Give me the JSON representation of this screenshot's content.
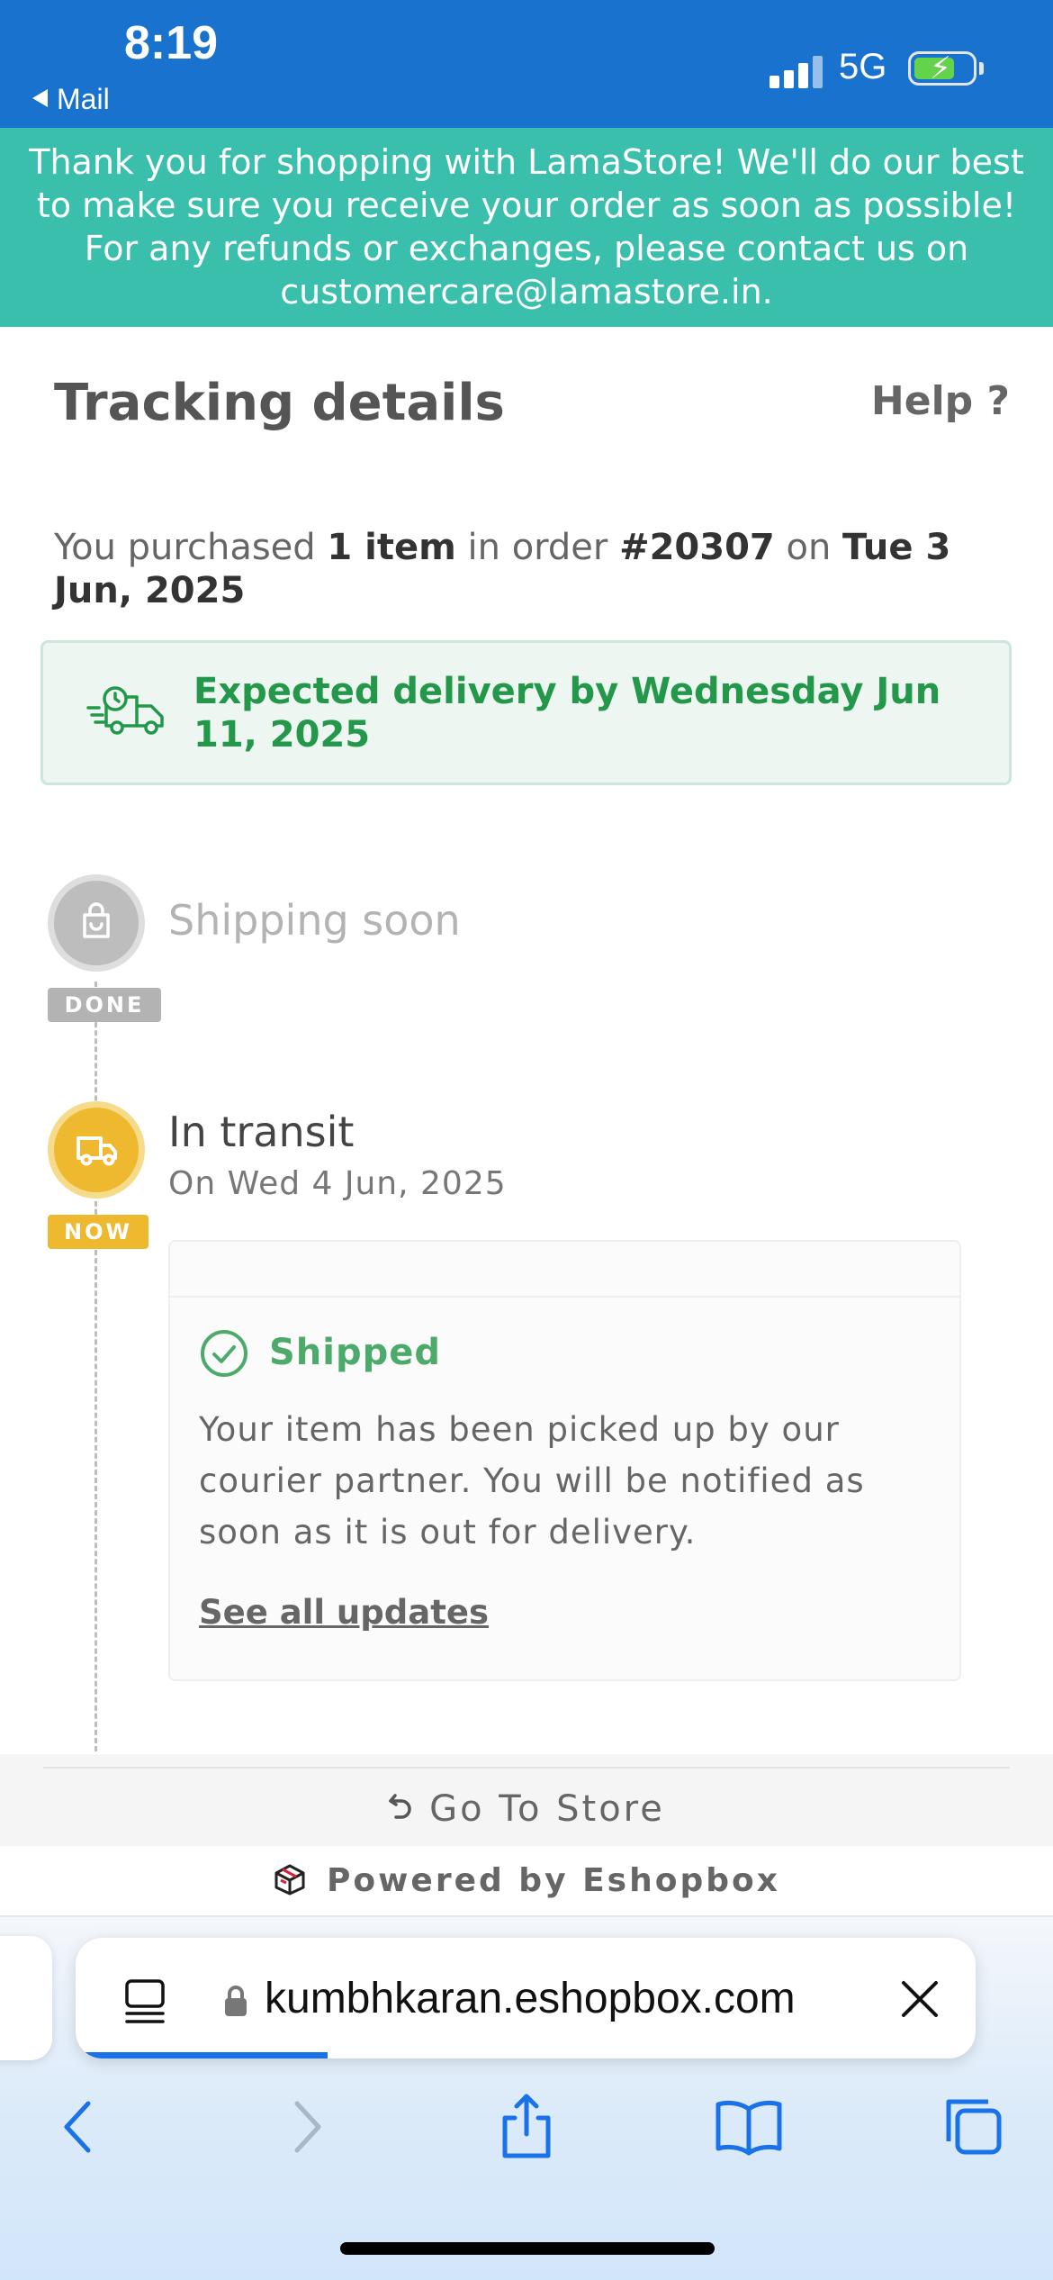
{
  "status_bar": {
    "time": "8:19",
    "back_label": "Mail",
    "network": "5G",
    "battery_charging": true
  },
  "banner": {
    "text": "Thank you for shopping with LamaStore! We'll do our best to make sure you receive your order as soon as possible! For any refunds or exchanges, please contact us on customercare@lamastore.in."
  },
  "header": {
    "title": "Tracking details",
    "help": "Help ?"
  },
  "purchase": {
    "prefix": "You purchased ",
    "item_count": "1 item",
    "middle": " in order ",
    "order_number": "#20307",
    "on": " on ",
    "order_date": "Tue 3 Jun, 2025"
  },
  "delivery": {
    "text": "Expected delivery by Wednesday Jun 11, 2025",
    "icon": "delivery-truck-icon",
    "color": "#23984a"
  },
  "timeline": {
    "steps": [
      {
        "title": "Shipping soon",
        "badge": "DONE",
        "icon": "shopping-bag-icon",
        "badge_color": "#b3b3b3"
      },
      {
        "title": "In transit",
        "badge": "NOW",
        "date": "On Wed 4 Jun, 2025",
        "icon": "truck-icon",
        "badge_color": "#efb92f"
      }
    ],
    "update": {
      "status": "Shipped",
      "message": "Your item has been picked up by our courier partner. You will be notified as soon as it is out for delivery.",
      "link": "See all updates"
    }
  },
  "footer": {
    "go_to_store": "Go To Store",
    "powered_by": "Powered by Eshopbox"
  },
  "browser": {
    "url": "kumbhkaran.eshopbox.com",
    "load_progress": 0.28
  }
}
